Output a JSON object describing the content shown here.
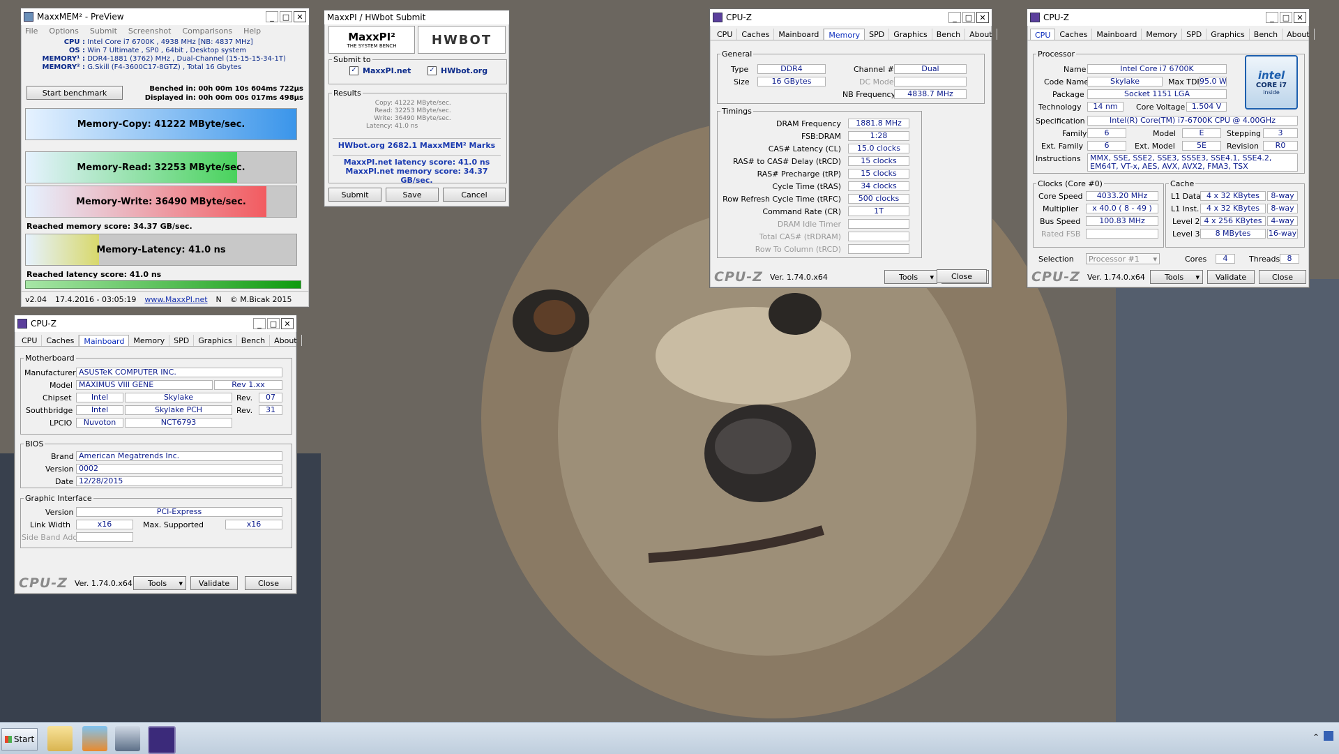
{
  "maxxmem": {
    "title": "MaxxMEM² - PreView",
    "menu": [
      "File",
      "Options",
      "Submit",
      "Screenshot",
      "Comparisons",
      "Help"
    ],
    "info": [
      {
        "k": "CPU :",
        "v": "Intel Core i7 6700K , 4938 MHz  [NB: 4837 MHz]"
      },
      {
        "k": "OS :",
        "v": "Win 7 Ultimate , SP0 , 64bit , Desktop system"
      },
      {
        "k": "MEMORY¹ :",
        "v": "DDR4-1881 (3762) MHz , Dual-Channel (15-15-15-34-1T)"
      },
      {
        "k": "MEMORY² :",
        "v": "G.Skill (F4-3600C17-8GTZ) , Total 16 Gbytes"
      }
    ],
    "start_button": "Start benchmark",
    "benched": "Benched in: 00h 00m 10s 604ms 722µs",
    "displayed": "Displayed in: 00h 00m 00s 017ms 498µs",
    "bars": [
      {
        "label": "Memory-Copy: 41222 MByte/sec.",
        "fill": 1.0,
        "color": "#3a95ea"
      },
      {
        "label": "Memory-Read: 32253 MByte/sec.",
        "fill": 0.78,
        "color": "#49d25c"
      },
      {
        "label": "Memory-Write: 36490 MByte/sec.",
        "fill": 0.89,
        "color": "#f25b60"
      },
      {
        "label": "Memory-Latency: 41.0 ns",
        "fill": 0.27,
        "color": "#d8d86b"
      }
    ],
    "memory_score": "Reached memory score: 34.37 GB/sec.",
    "latency_score": "Reached latency score: 41.0 ns",
    "status": {
      "version": "v2.04",
      "date": "17.4.2016 - 03:05:19",
      "link": "www.MaxxPI.net",
      "n": "N",
      "copy": "© M.Bicak 2015"
    }
  },
  "hwbot": {
    "title": "MaxxPI / HWbot Submit",
    "logo_left": "MaxxPI²",
    "logo_sub": "THE SYSTEM BENCH",
    "logo_right": "HWBOT",
    "submit_to": "Submit to",
    "maxxpi_check": "MaxxPI.net",
    "hwbot_check": "HWbot.org",
    "results_label": "Results",
    "results": [
      {
        "k": "Copy:",
        "v": "41222 MByte/sec."
      },
      {
        "k": "Read:",
        "v": "32253 MByte/sec."
      },
      {
        "k": "Write:",
        "v": "36490 MByte/sec."
      },
      {
        "k": "Latency:",
        "v": "41.0 ns"
      }
    ],
    "hwbot_marks": "HWbot.org  2682.1  MaxxMEM² Marks",
    "latency_score": "MaxxPI.net latency score:  41.0  ns",
    "memory_score": "MaxxPI.net memory score:  34.37  GB/sec.",
    "submit": "Submit",
    "save": "Save",
    "cancel": "Cancel"
  },
  "cpuz_common": {
    "title": "CPU-Z",
    "tabs": [
      "CPU",
      "Caches",
      "Mainboard",
      "Memory",
      "SPD",
      "Graphics",
      "Bench",
      "About"
    ],
    "logo": "CPU-Z",
    "version": "Ver. 1.74.0.x64",
    "tools": "Tools",
    "validate": "Validate",
    "close": "Close"
  },
  "cpuz_mem": {
    "general": "General",
    "type_l": "Type",
    "type": "DDR4",
    "size_l": "Size",
    "size": "16 GBytes",
    "channel_l": "Channel #",
    "channel": "Dual",
    "dc_l": "DC Mode",
    "dc": "",
    "nb_l": "NB Frequency",
    "nb": "4838.7 MHz",
    "timings": "Timings",
    "rows": [
      {
        "k": "DRAM Frequency",
        "v": "1881.8 MHz",
        "dim": false
      },
      {
        "k": "FSB:DRAM",
        "v": "1:28",
        "dim": false
      },
      {
        "k": "CAS# Latency (CL)",
        "v": "15.0 clocks",
        "dim": false
      },
      {
        "k": "RAS# to CAS# Delay (tRCD)",
        "v": "15 clocks",
        "dim": false
      },
      {
        "k": "RAS# Precharge (tRP)",
        "v": "15 clocks",
        "dim": false
      },
      {
        "k": "Cycle Time (tRAS)",
        "v": "34 clocks",
        "dim": false
      },
      {
        "k": "Row Refresh Cycle Time (tRFC)",
        "v": "500 clocks",
        "dim": false
      },
      {
        "k": "Command Rate (CR)",
        "v": "1T",
        "dim": false
      },
      {
        "k": "DRAM Idle Timer",
        "v": "",
        "dim": true
      },
      {
        "k": "Total CAS# (tRDRAM)",
        "v": "",
        "dim": true
      },
      {
        "k": "Row To Column (tRCD)",
        "v": "",
        "dim": true
      }
    ]
  },
  "cpuz_cpu": {
    "processor": "Processor",
    "name_l": "Name",
    "name": "Intel Core i7 6700K",
    "code_l": "Code Name",
    "code": "Skylake",
    "tdp_l": "Max TDP",
    "tdp": "95.0 W",
    "pkg_l": "Package",
    "pkg": "Socket 1151 LGA",
    "tech_l": "Technology",
    "tech": "14 nm",
    "cv_l": "Core Voltage",
    "cv": "1.504 V",
    "spec_l": "Specification",
    "spec": "Intel(R) Core(TM) i7-6700K CPU @ 4.00GHz",
    "family_l": "Family",
    "family": "6",
    "model_l": "Model",
    "model": "E",
    "stepping_l": "Stepping",
    "stepping": "3",
    "extfam_l": "Ext. Family",
    "extfam": "6",
    "extmodel_l": "Ext. Model",
    "extmodel": "5E",
    "rev_l": "Revision",
    "rev": "R0",
    "instr_l": "Instructions",
    "instr": "MMX, SSE, SSE2, SSE3, SSSE3, SSE4.1, SSE4.2, EM64T, VT-x, AES, AVX, AVX2, FMA3, TSX",
    "intel_badge1": "intel",
    "intel_badge2": "CORE i7",
    "intel_badge3": "inside",
    "clocks": "Clocks (Core #0)",
    "cs_l": "Core Speed",
    "cs": "4033.20 MHz",
    "mult_l": "Multiplier",
    "mult": "x 40.0 ( 8 - 49 )",
    "bus_l": "Bus Speed",
    "bus": "100.83 MHz",
    "fsb_l": "Rated FSB",
    "fsb": "",
    "cache": "Cache",
    "l1d_l": "L1 Data",
    "l1d": "4 x 32 KBytes",
    "l1d_w": "8-way",
    "l1i_l": "L1 Inst.",
    "l1i": "4 x 32 KBytes",
    "l1i_w": "8-way",
    "l2_l": "Level 2",
    "l2": "4 x 256 KBytes",
    "l2_w": "4-way",
    "l3_l": "Level 3",
    "l3": "8 MBytes",
    "l3_w": "16-way",
    "sel_l": "Selection",
    "sel": "Processor #1",
    "cores_l": "Cores",
    "cores": "4",
    "threads_l": "Threads",
    "threads": "8"
  },
  "cpuz_mb": {
    "motherboard": "Motherboard",
    "manu_l": "Manufacturer",
    "manu": "ASUSTeK COMPUTER INC.",
    "model_l": "Model",
    "model": "MAXIMUS VIII GENE",
    "model_rev": "Rev 1.xx",
    "chip_l": "Chipset",
    "chip_v": "Intel",
    "chip_n": "Skylake",
    "chip_rev_l": "Rev.",
    "chip_rev": "07",
    "sb_l": "Southbridge",
    "sb_v": "Intel",
    "sb_n": "Skylake PCH",
    "sb_rev_l": "Rev.",
    "sb_rev": "31",
    "lpcio_l": "LPCIO",
    "lpcio_v": "Nuvoton",
    "lpcio_n": "NCT6793",
    "bios": "BIOS",
    "brand_l": "Brand",
    "brand": "American Megatrends Inc.",
    "bver_l": "Version",
    "bver": "0002",
    "bdate_l": "Date",
    "bdate": "12/28/2015",
    "gi": "Graphic Interface",
    "gver_l": "Version",
    "gver": "PCI-Express",
    "lw_l": "Link Width",
    "lw": "x16",
    "ms_l": "Max. Supported",
    "ms": "x16",
    "sba_l": "Side Band Addressing",
    "sba": ""
  },
  "taskbar": {
    "start": "Start"
  }
}
